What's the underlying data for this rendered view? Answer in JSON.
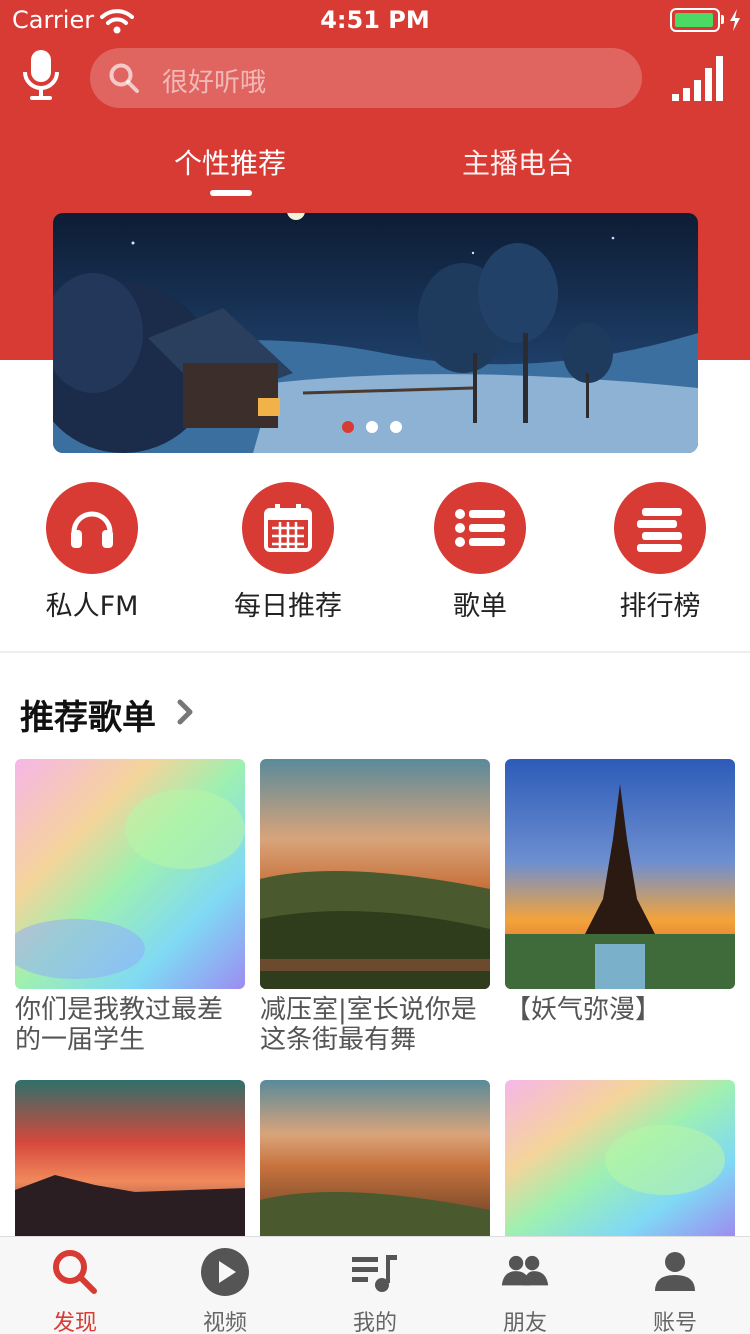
{
  "status_bar": {
    "carrier": "Carrier",
    "time": "4:51 PM"
  },
  "header": {
    "search_placeholder": "很好听哦"
  },
  "top_tabs": [
    {
      "label": "个性推荐",
      "active": true
    },
    {
      "label": "主播电台",
      "active": false
    }
  ],
  "banner": {
    "page_count": 3,
    "current_page": 1
  },
  "entries": [
    {
      "label": "私人FM",
      "icon": "headphones-icon"
    },
    {
      "label": "每日推荐",
      "icon": "calendar-icon"
    },
    {
      "label": "歌单",
      "icon": "list-icon"
    },
    {
      "label": "排行榜",
      "icon": "ranking-icon"
    }
  ],
  "section": {
    "title": "推荐歌单"
  },
  "playlists": [
    {
      "title": "你们是我教过最差的一届学生"
    },
    {
      "title": "减压室|室长说你是这条街最有舞"
    },
    {
      "title": "【妖气弥漫】"
    },
    {
      "title": ""
    },
    {
      "title": ""
    },
    {
      "title": ""
    }
  ],
  "tabbar": [
    {
      "label": "发现",
      "icon": "search-icon",
      "active": true
    },
    {
      "label": "视频",
      "icon": "play-icon",
      "active": false
    },
    {
      "label": "我的",
      "icon": "music-list-icon",
      "active": false
    },
    {
      "label": "朋友",
      "icon": "friends-icon",
      "active": false
    },
    {
      "label": "账号",
      "icon": "account-icon",
      "active": false
    }
  ],
  "colors": {
    "brand_red": "#d83a34",
    "tab_active": "#d83a34",
    "tab_inactive": "#666666"
  }
}
